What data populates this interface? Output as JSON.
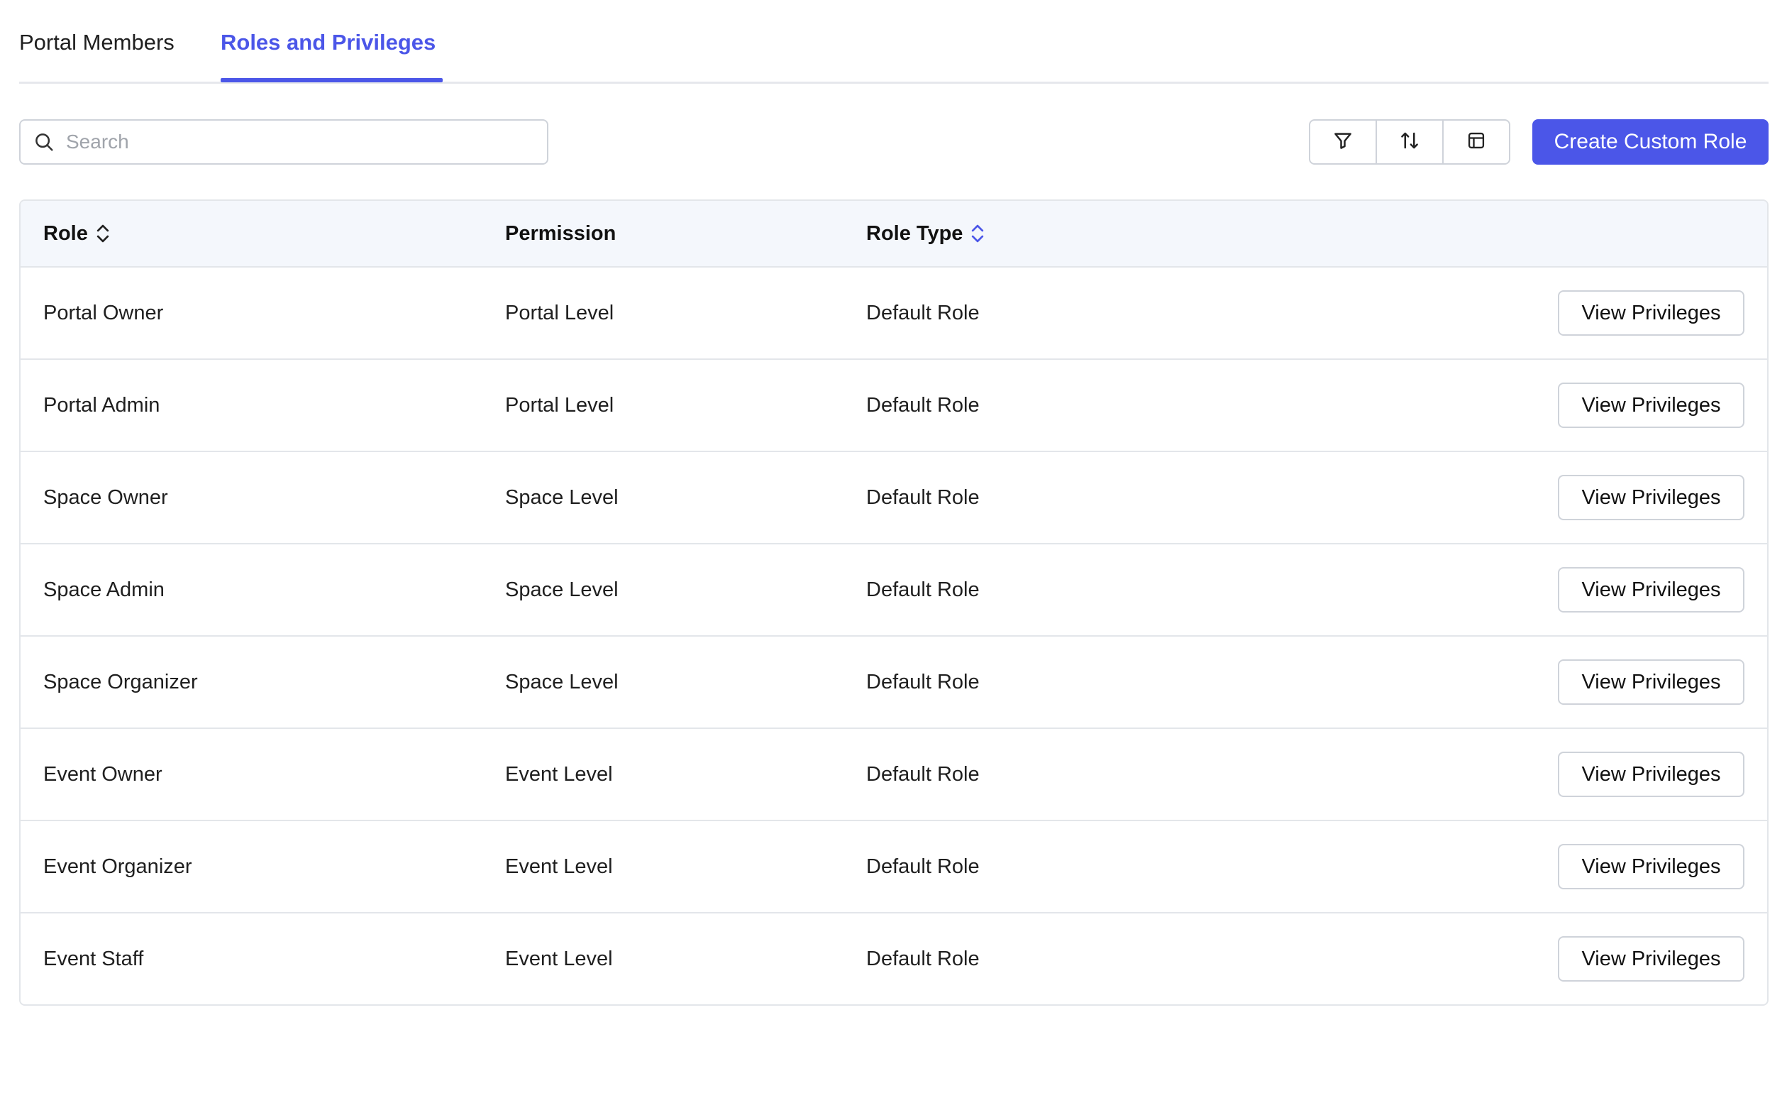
{
  "tabs": [
    {
      "label": "Portal Members",
      "active": false
    },
    {
      "label": "Roles and Privileges",
      "active": true
    }
  ],
  "search": {
    "placeholder": "Search",
    "value": ""
  },
  "toolbar": {
    "icons": [
      "filter-icon",
      "sort-icon",
      "column-layout-icon"
    ],
    "create_label": "Create Custom Role"
  },
  "colors": {
    "accent": "#4b56e8",
    "header_bg": "#f4f7fc",
    "border": "#e3e6ea"
  },
  "table": {
    "headers": {
      "role": "Role",
      "permission": "Permission",
      "role_type": "Role Type"
    },
    "action_label": "View Privileges",
    "rows": [
      {
        "role": "Portal Owner",
        "permission": "Portal Level",
        "role_type": "Default Role"
      },
      {
        "role": "Portal Admin",
        "permission": "Portal Level",
        "role_type": "Default Role"
      },
      {
        "role": "Space Owner",
        "permission": "Space Level",
        "role_type": "Default Role"
      },
      {
        "role": "Space Admin",
        "permission": "Space Level",
        "role_type": "Default Role"
      },
      {
        "role": "Space Organizer",
        "permission": "Space Level",
        "role_type": "Default Role"
      },
      {
        "role": "Event Owner",
        "permission": "Event Level",
        "role_type": "Default Role"
      },
      {
        "role": "Event Organizer",
        "permission": "Event Level",
        "role_type": "Default Role"
      },
      {
        "role": "Event Staff",
        "permission": "Event Level",
        "role_type": "Default Role"
      }
    ]
  }
}
